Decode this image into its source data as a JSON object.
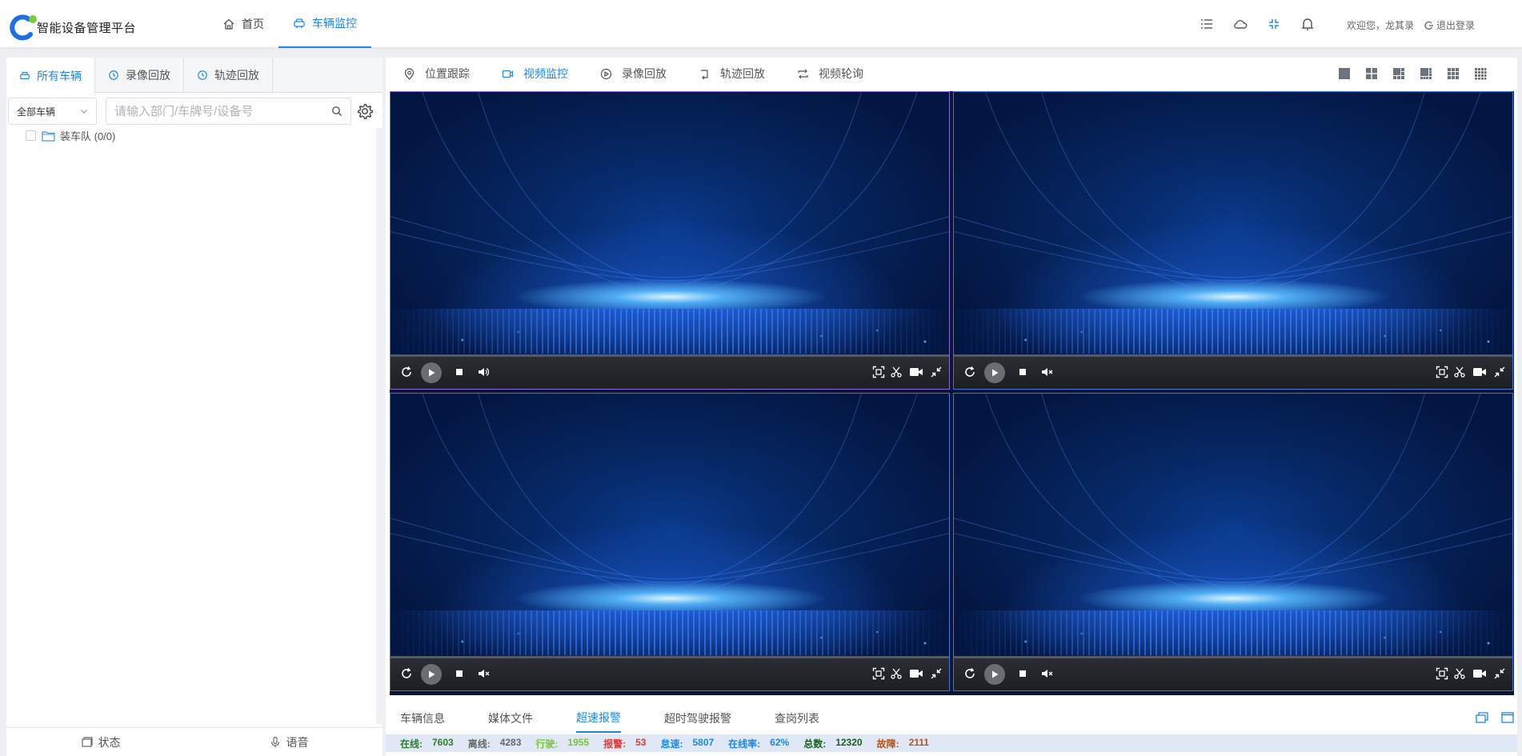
{
  "app": {
    "title": "智能设备管理平台"
  },
  "nav": {
    "items": [
      {
        "label": "首页",
        "icon": "home-icon"
      },
      {
        "label": "车辆监控",
        "icon": "car-icon",
        "active": true
      }
    ]
  },
  "header": {
    "welcome": "欢迎您，龙其录",
    "logout": "退出登录"
  },
  "left": {
    "tabs": [
      {
        "label": "所有车辆",
        "icon": "car-icon",
        "active": true
      },
      {
        "label": "录像回放",
        "icon": "clock-icon"
      },
      {
        "label": "轨迹回放",
        "icon": "clock-icon"
      }
    ],
    "filter": {
      "selected": "全部车辆"
    },
    "search": {
      "placeholder": "请输入部门/车牌号/设备号",
      "value": ""
    },
    "tree": [
      {
        "label": "装车队 (0/0)"
      }
    ],
    "bottom": [
      {
        "label": "状态"
      },
      {
        "label": "语音"
      }
    ]
  },
  "subnav": {
    "items": [
      {
        "label": "位置跟踪",
        "icon": "location-icon"
      },
      {
        "label": "视频监控",
        "icon": "video-icon",
        "active": true
      },
      {
        "label": "录像回放",
        "icon": "play-circle-icon"
      },
      {
        "label": "轨迹回放",
        "icon": "track-icon"
      },
      {
        "label": "视频轮询",
        "icon": "loop-icon"
      }
    ]
  },
  "video_panes": [
    {
      "id": 1,
      "selected": true,
      "muted": false
    },
    {
      "id": 2,
      "selected": false,
      "muted": true
    },
    {
      "id": 3,
      "selected": false,
      "muted": true
    },
    {
      "id": 4,
      "selected": false,
      "muted": true
    }
  ],
  "bottom_tabs": [
    {
      "label": "车辆信息"
    },
    {
      "label": "媒体文件"
    },
    {
      "label": "超速报警",
      "active": true
    },
    {
      "label": "超时驾驶报警"
    },
    {
      "label": "查岗列表"
    }
  ],
  "stats": [
    {
      "label": "在线:",
      "value": "7603",
      "color": "#2e7d32"
    },
    {
      "label": "离线:",
      "value": "4283",
      "color": "#666666"
    },
    {
      "label": "行驶:",
      "value": "1955",
      "color": "#7cc33a"
    },
    {
      "label": "报警:",
      "value": "53",
      "color": "#e53935"
    },
    {
      "label": "怠速:",
      "value": "5807",
      "color": "#1e88e5"
    },
    {
      "label": "在线率:",
      "value": "62%",
      "color": "#1e88e5"
    },
    {
      "label": "总数:",
      "value": "12320",
      "color": "#1b5e20"
    },
    {
      "label": "故障:",
      "value": "2111",
      "color": "#b7531c"
    }
  ],
  "colors": {
    "accent": "#1e88e5",
    "video_bg": "#062763",
    "pane_border": "#3a77d9",
    "pane_selected_border": "#8a6ad8"
  }
}
